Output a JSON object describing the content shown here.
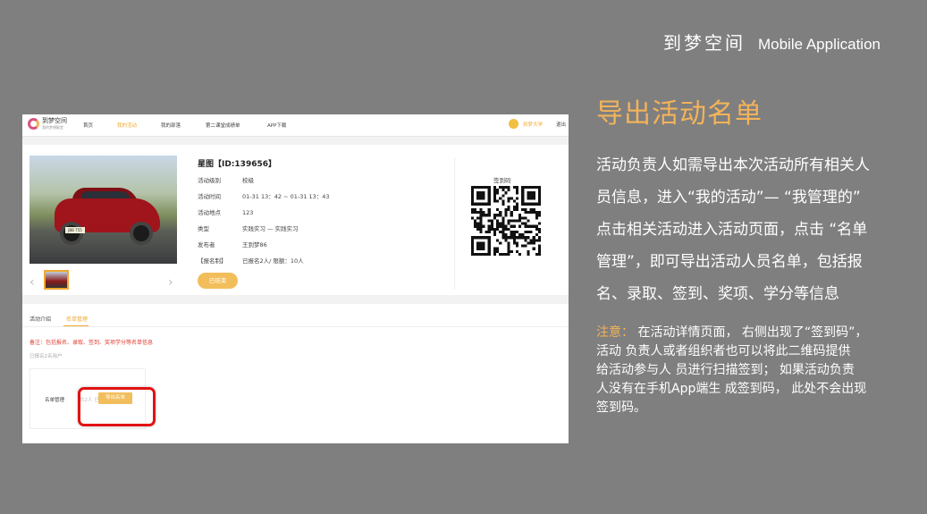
{
  "header": {
    "brand_cn": "到梦空间",
    "brand_en": "Mobile Application"
  },
  "screenshot": {
    "site": {
      "logo_name": "到梦空间",
      "logo_sub": "我的梦想殿堂",
      "nav": [
        "首页",
        "我的活动",
        "我的部落",
        "第二课堂成绩单",
        "APP下载"
      ],
      "active_nav": "我的活动",
      "user": "到梦大学",
      "more": "退出"
    },
    "activity": {
      "title": "星图【ID:139656】",
      "fields": [
        {
          "k": "活动级别",
          "v": "校级"
        },
        {
          "k": "活动时间",
          "v": "01-31 13：42 ~ 01-31 13：43"
        },
        {
          "k": "活动地点",
          "v": "123"
        },
        {
          "k": "类型",
          "v": "实践实习 — 实践实习"
        },
        {
          "k": "发布者",
          "v": "王到梦86"
        },
        {
          "k": "【报名制】",
          "v": "已报名2人/ 限额：10人"
        }
      ],
      "status_button": "已结束",
      "qr_label": "签到码",
      "plate": "JBB 755"
    },
    "tabs": [
      "活动介绍",
      "名单管理"
    ],
    "active_tab": "名单管理",
    "note": "备注：包括报名、录取、签到、奖项学分等名单信息",
    "count": "已报名2名用户",
    "list_label": "名单管理",
    "list_hint": "共2人 已录",
    "export_button": "导出名单"
  },
  "right": {
    "title": "导出活动名单",
    "desc_lines": [
      "活动负责人如需导出本次活动所有相关人",
      "  员信息，进入“我的活动”— “我管理的”",
      "  点击相关活动进入活动页面，点击 “名单",
      "  管理”，即可导出活动人员名单，包括报",
      "  名、录取、签到、奖项、学分等信息"
    ],
    "note_label": "注意：",
    "note_lines": [
      "  在活动详情页面， 右侧出现了“签到码”，",
      "活动 负责人或者组织者也可以将此二维码提供",
      "给活动参与人 员进行扫描签到； 如果活动负责",
      "人没有在手机App端生 成签到码， 此处不会出现",
      "签到码。"
    ]
  },
  "colors": {
    "background": "#7f7f7f",
    "accent": "#f3b35a",
    "highlight": "#e21212"
  }
}
